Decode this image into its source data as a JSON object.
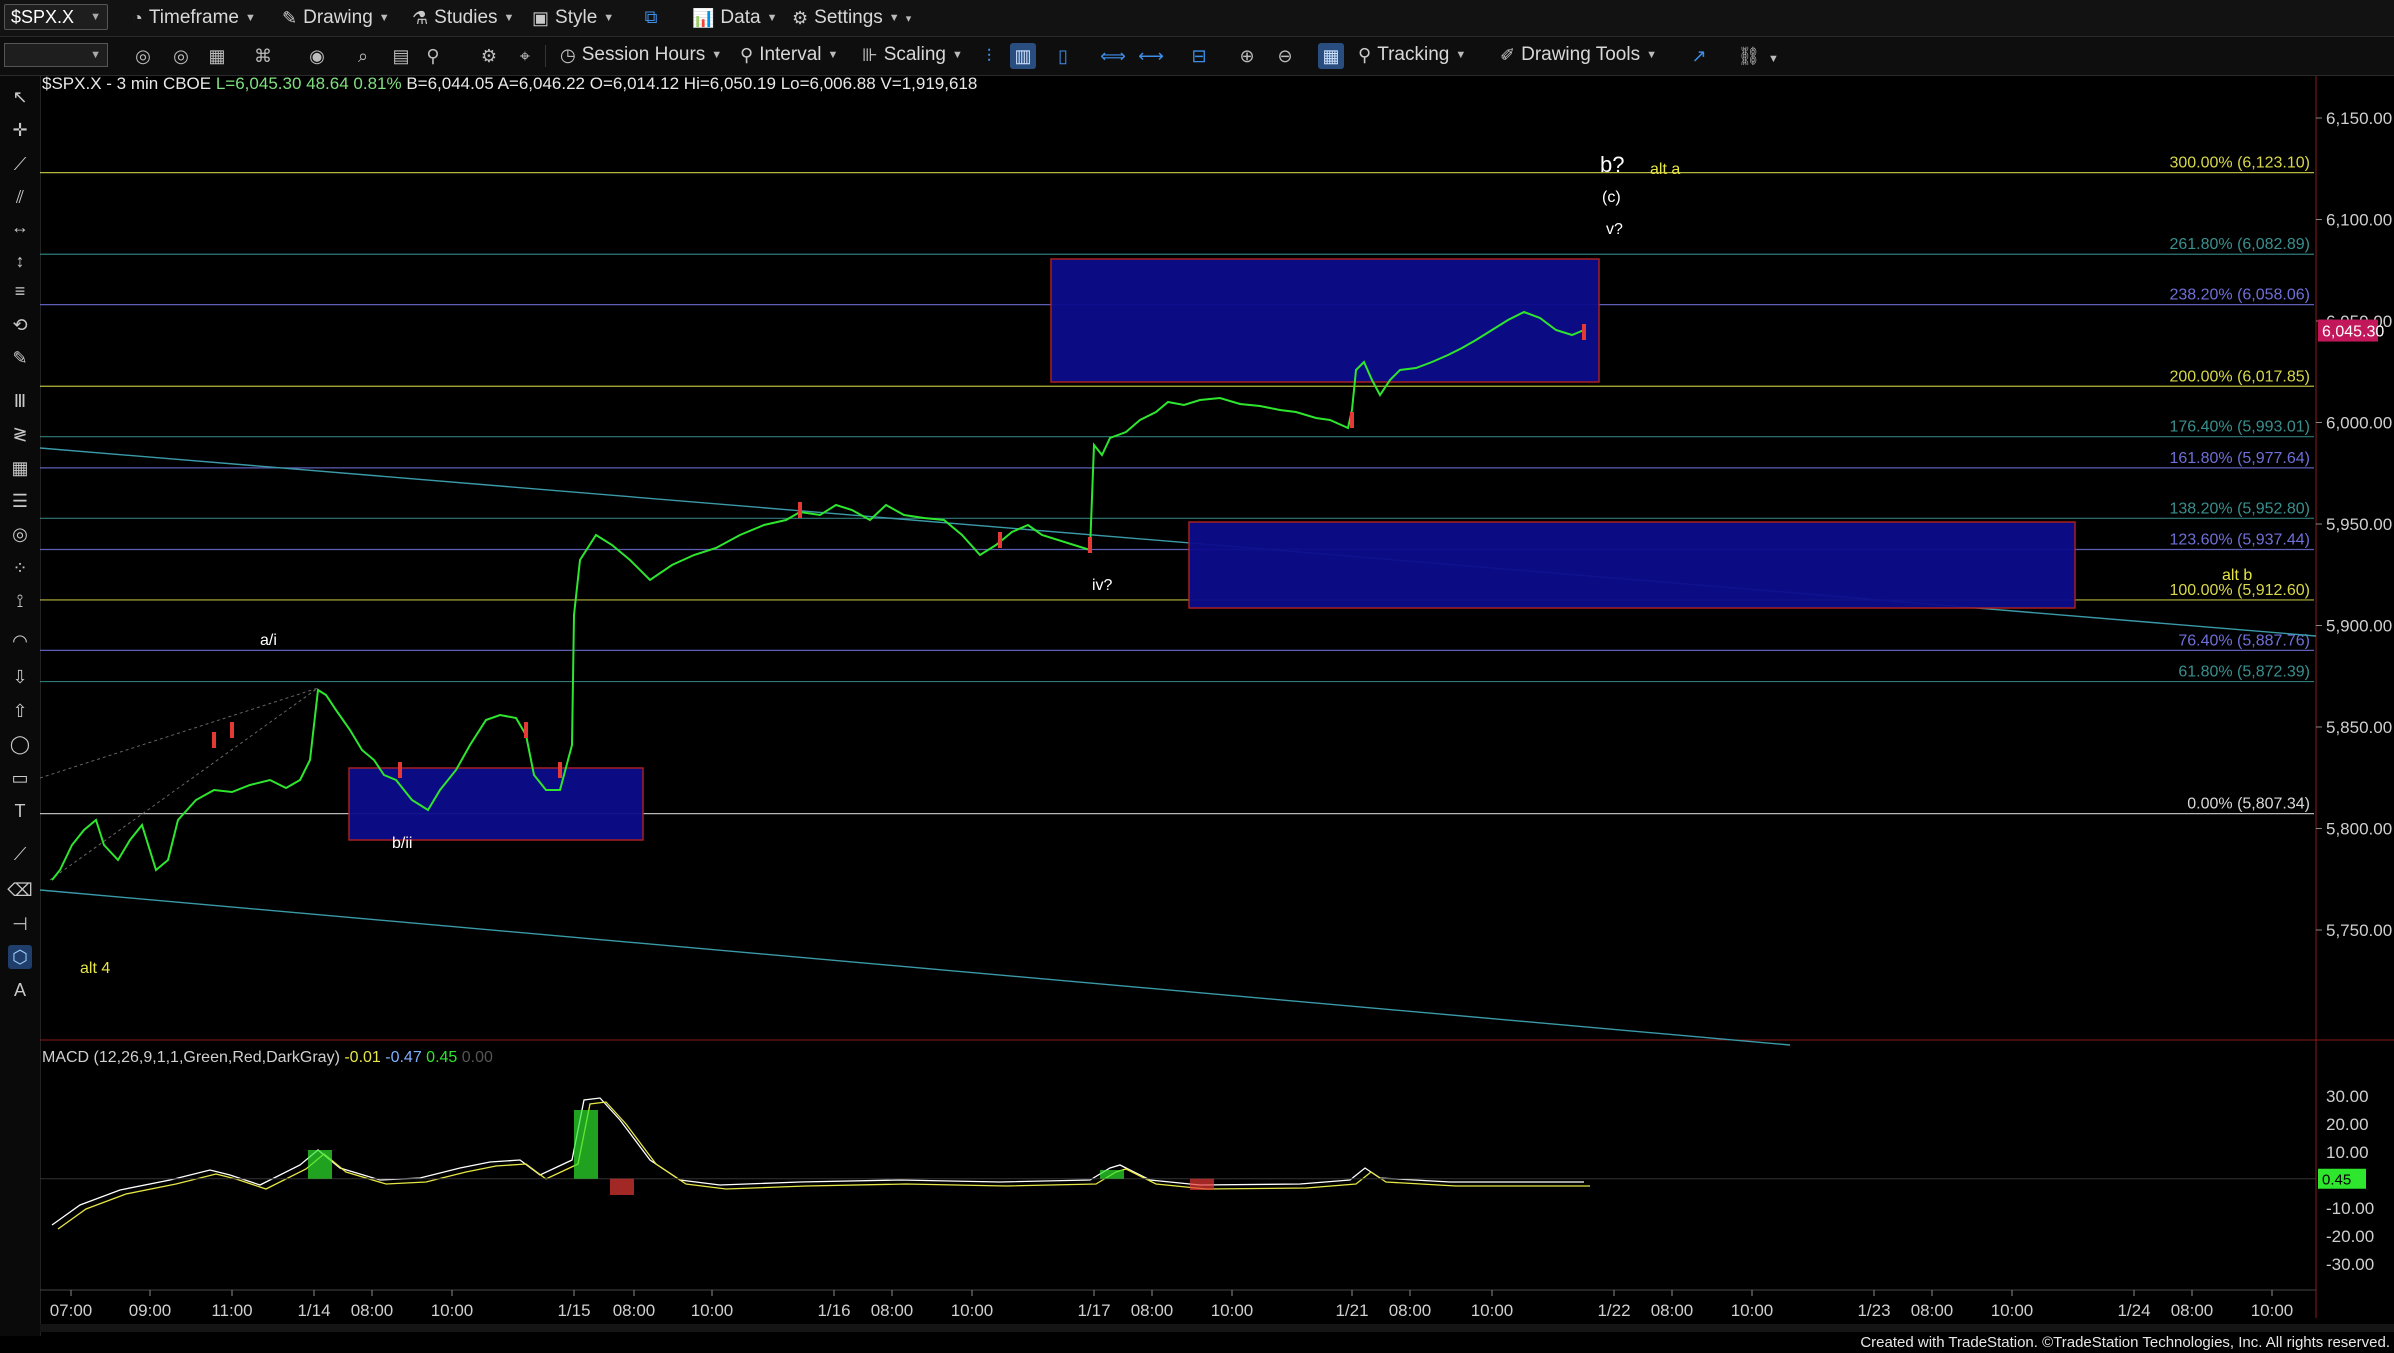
{
  "toolbar1": {
    "symbol": "$SPX.X",
    "timeframe": "Timeframe",
    "drawing": "Drawing",
    "studies": "Studies",
    "style": "Style",
    "data": "Data",
    "settings": "Settings"
  },
  "toolbar2": {
    "session_hours": "Session Hours",
    "interval": "Interval",
    "scaling": "Scaling",
    "tracking": "Tracking",
    "drawing_tools": "Drawing Tools"
  },
  "icons": {
    "toolbar": [
      "timeframe-icon",
      "drawing-icon",
      "studies-icon",
      "style-icon",
      "layout-icon",
      "data-icon",
      "settings-icon",
      "session-hours-icon",
      "interval-icon",
      "scaling-icon",
      "zoom-in-icon",
      "zoom-out-icon",
      "tracking-icon",
      "drawing-tools-icon"
    ],
    "left": [
      "pointer-icon",
      "crosshair-icon",
      "trendline-icon",
      "fib-icon",
      "horizontal-icon",
      "vertical-icon",
      "channel-icon",
      "gann-icon",
      "pencil-icon",
      "bars-icon",
      "regression-icon",
      "grid-icon",
      "lines-icon",
      "cycle-icon",
      "dots-icon",
      "speed-icon",
      "arc-icon",
      "arrow-down-icon",
      "arrow-up-icon",
      "ellipse-icon",
      "rectangle-icon",
      "text-icon",
      "ruler-icon",
      "eraser-icon",
      "snap-icon",
      "draw-mode-icon",
      "text-a-icon"
    ]
  },
  "header_info": {
    "symbol": "$SPX.X - 3 min",
    "exchange": "CBOE",
    "last": "L=6,045.30",
    "change": "48.64",
    "change_pct": "0.81%",
    "bid": "B=6,044.05",
    "ask": "A=6,046.22",
    "open": "O=6,014.12",
    "high": "Hi=6,050.19",
    "low": "Lo=6,006.88",
    "volume": "V=1,919,618"
  },
  "price_axis": {
    "labels": [
      "6,150.00",
      "6,100.00",
      "6,050.00",
      "6,000.00",
      "5,950.00",
      "5,900.00",
      "5,850.00",
      "5,800.00",
      "5,750.00"
    ],
    "current_price": "6,045.30",
    "current_color": "#c2185b"
  },
  "time_axis": {
    "labels": [
      "07:00",
      "09:00",
      "11:00",
      "1/14",
      "08:00",
      "10:00",
      "1/15",
      "08:00",
      "10:00",
      "1/16",
      "08:00",
      "10:00",
      "1/17",
      "08:00",
      "10:00",
      "1/21",
      "08:00",
      "10:00",
      "1/22",
      "08:00",
      "10:00",
      "1/23",
      "08:00",
      "10:00",
      "1/24",
      "08:00",
      "10:00"
    ]
  },
  "fib_levels": [
    {
      "label": "300.00% (6,123.10)",
      "price": 6123.1,
      "color": "#d8d84a"
    },
    {
      "label": "261.80% (6,082.89)",
      "price": 6082.89,
      "color": "#3a8f8f"
    },
    {
      "label": "238.20% (6,058.06)",
      "price": 6058.06,
      "color": "#6f6fd8"
    },
    {
      "label": "200.00% (6,017.85)",
      "price": 6017.85,
      "color": "#d8d84a"
    },
    {
      "label": "176.40% (5,993.01)",
      "price": 5993.01,
      "color": "#3a8f8f"
    },
    {
      "label": "161.80% (5,977.64)",
      "price": 5977.64,
      "color": "#6f6fd8"
    },
    {
      "label": "138.20% (5,952.80)",
      "price": 5952.8,
      "color": "#3a8f8f"
    },
    {
      "label": "123.60% (5,937.44)",
      "price": 5937.44,
      "color": "#6f6fd8"
    },
    {
      "label": "100.00% (5,912.60)",
      "price": 5912.6,
      "color": "#d8d84a"
    },
    {
      "label": "76.40% (5,887.76)",
      "price": 5887.76,
      "color": "#6f6fd8"
    },
    {
      "label": "61.80% (5,872.39)",
      "price": 5872.39,
      "color": "#3a8f8f"
    },
    {
      "label": "0.00% (5,807.34)",
      "price": 5807.34,
      "color": "#d8d8d8"
    }
  ],
  "wave_labels": [
    {
      "text": "b?",
      "color": "#ffffff"
    },
    {
      "text": "alt a",
      "color": "#e6e645"
    },
    {
      "text": "(c)",
      "color": "#ffffff"
    },
    {
      "text": "v?",
      "color": "#ffffff"
    },
    {
      "text": "iv?",
      "color": "#ffffff"
    },
    {
      "text": "alt b",
      "color": "#e6e645"
    },
    {
      "text": "a/i",
      "color": "#ffffff"
    },
    {
      "text": "b/ii",
      "color": "#ffffff"
    },
    {
      "text": "alt 4",
      "color": "#e6e645"
    }
  ],
  "macd": {
    "title": "MACD (12,26,9,1,1,Green,Red,DarkGray)",
    "v1": "-0.01",
    "v2": "-0.47",
    "v3": "0.45",
    "v4": "0.00",
    "axis_labels": [
      "30.00",
      "20.00",
      "10.00",
      "0.45",
      "-10.00",
      "-20.00",
      "-30.00"
    ]
  },
  "footer": "Created with TradeStation. ©TradeStation Technologies, Inc. All rights reserved."
}
